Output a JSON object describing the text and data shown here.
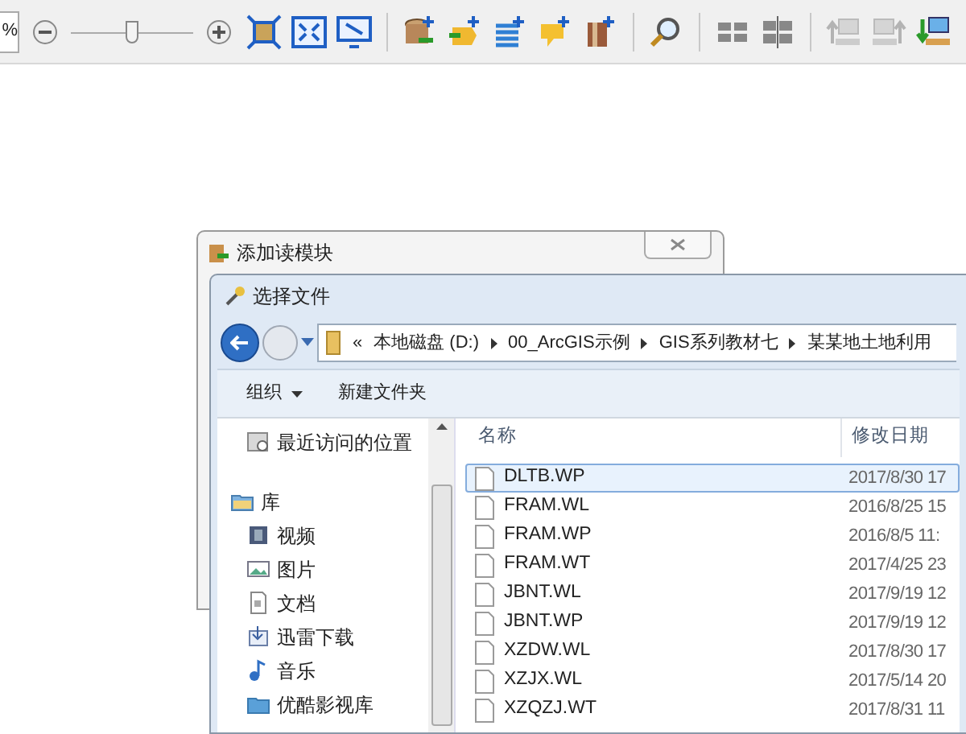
{
  "toolbar": {
    "zoom_text": "%",
    "zoom_slider": {
      "level": 0.5
    }
  },
  "back_dialog": {
    "title": "添加读模块"
  },
  "file_dialog": {
    "title": "选择文件",
    "breadcrumb": {
      "overflow": "«",
      "segments": [
        "本地磁盘 (D:)",
        "00_ArcGIS示例",
        "GIS系列教材七",
        "某某地土地利用"
      ]
    },
    "commands": [
      {
        "label": "组织",
        "dropdown": true
      },
      {
        "label": "新建文件夹",
        "dropdown": false
      }
    ],
    "sidebar": {
      "items": [
        {
          "label": "最近访问的位置",
          "kind": "item"
        },
        {
          "label": "库",
          "kind": "group"
        },
        {
          "label": "视频",
          "kind": "item"
        },
        {
          "label": "图片",
          "kind": "item"
        },
        {
          "label": "文档",
          "kind": "item"
        },
        {
          "label": "迅雷下载",
          "kind": "item"
        },
        {
          "label": "音乐",
          "kind": "item"
        },
        {
          "label": "优酷影视库",
          "kind": "item"
        }
      ]
    },
    "table": {
      "columns": [
        "名称",
        "修改日期"
      ],
      "rows": [
        {
          "name": "DLTB.WP",
          "date": "2017/8/30 17",
          "selected": true
        },
        {
          "name": "FRAM.WL",
          "date": "2016/8/25 15",
          "selected": false
        },
        {
          "name": "FRAM.WP",
          "date": "2016/8/5 11:",
          "selected": false
        },
        {
          "name": "FRAM.WT",
          "date": "2017/4/25 23",
          "selected": false
        },
        {
          "name": "JBNT.WL",
          "date": "2017/9/19 12",
          "selected": false
        },
        {
          "name": "JBNT.WP",
          "date": "2017/9/19 12",
          "selected": false
        },
        {
          "name": "XZDW.WL",
          "date": "2017/8/30 17",
          "selected": false
        },
        {
          "name": "XZJX.WL",
          "date": "2017/5/14 20",
          "selected": false
        },
        {
          "name": "XZQZJ.WT",
          "date": "2017/8/31 11",
          "selected": false
        }
      ]
    }
  }
}
